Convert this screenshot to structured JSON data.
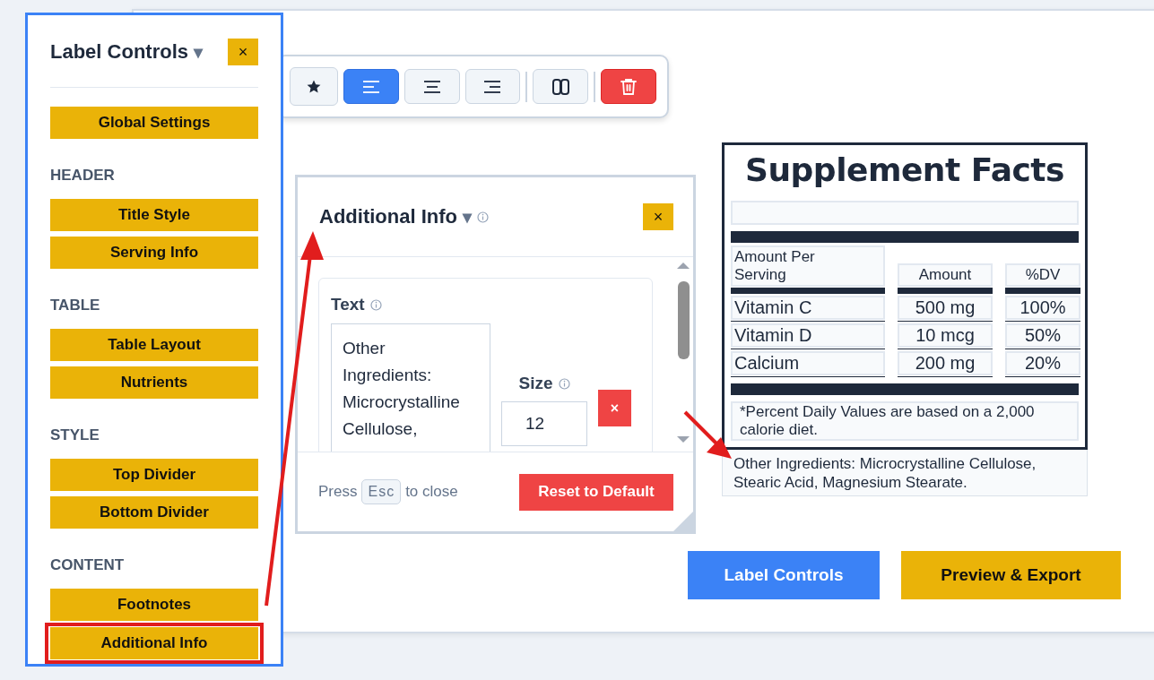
{
  "sidebar": {
    "title": "Label Controls",
    "caret": "▾",
    "close": "×",
    "items": [
      {
        "kind": "button",
        "label": "Global Settings",
        "highlighted": false
      },
      {
        "kind": "section",
        "label": "HEADER"
      },
      {
        "kind": "button",
        "label": "Title Style",
        "highlighted": false
      },
      {
        "kind": "button",
        "label": "Serving Info",
        "highlighted": false
      },
      {
        "kind": "section",
        "label": "TABLE"
      },
      {
        "kind": "button",
        "label": "Table Layout",
        "highlighted": false
      },
      {
        "kind": "button",
        "label": "Nutrients",
        "highlighted": false
      },
      {
        "kind": "section",
        "label": "STYLE"
      },
      {
        "kind": "button",
        "label": "Top Divider",
        "highlighted": false
      },
      {
        "kind": "button",
        "label": "Bottom Divider",
        "highlighted": false
      },
      {
        "kind": "section",
        "label": "CONTENT"
      },
      {
        "kind": "button",
        "label": "Footnotes",
        "highlighted": false
      },
      {
        "kind": "button",
        "label": "Additional Info",
        "highlighted": true
      }
    ]
  },
  "toolbar": {
    "buttons": [
      {
        "kind": "star",
        "selected": false
      },
      {
        "kind": "align-left",
        "selected": true
      },
      {
        "kind": "align-center",
        "selected": false
      },
      {
        "kind": "align-right",
        "selected": false
      },
      {
        "kind": "separator"
      },
      {
        "kind": "columns",
        "selected": false
      },
      {
        "kind": "separator"
      },
      {
        "kind": "delete"
      }
    ]
  },
  "popover": {
    "title": "Additional Info",
    "caret": "▾",
    "close": "×",
    "text_label": "Text",
    "text_value": "Other Ingredients: Microcrystalline Cellulose,",
    "size_label": "Size",
    "size_value": "12",
    "clear": "×",
    "hint_before": "Press",
    "hint_key": "Esc",
    "hint_after": "to close",
    "reset": "Reset to Default"
  },
  "label": {
    "title": "Supplement Facts",
    "columns": [
      "Amount Per Serving",
      "Amount",
      "%DV"
    ],
    "rows": [
      [
        "Vitamin C",
        "500 mg",
        "100%"
      ],
      [
        "Vitamin D",
        "10 mcg",
        "50%"
      ],
      [
        "Calcium",
        "200 mg",
        "20%"
      ]
    ],
    "footnote": "*Percent Daily Values are based on a 2,000 calorie diet.",
    "other_ingredients": "Other Ingredients: Microcrystalline Cellulose, Stearic Acid, Magnesium Stearate."
  },
  "actions": [
    {
      "kind": "primary",
      "label": "Label Controls"
    },
    {
      "kind": "secondary",
      "label": "Preview & Export"
    }
  ],
  "annotations": [
    {
      "kind": "arrow"
    },
    {
      "kind": "arrow"
    }
  ]
}
